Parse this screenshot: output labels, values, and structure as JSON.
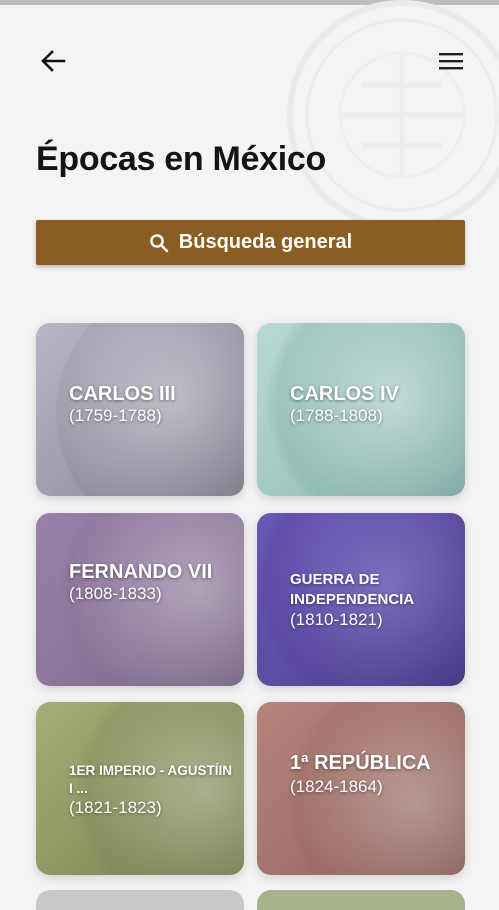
{
  "header": {
    "title": "Épocas en México",
    "back_icon": "arrow-left-icon",
    "menu_icon": "hamburger-menu-icon"
  },
  "search": {
    "label": "Búsqueda general",
    "icon": "search-icon",
    "color": "#8a5e22"
  },
  "eras": [
    {
      "name": "CARLOS III",
      "years": "(1759-1788)"
    },
    {
      "name": "CARLOS IV",
      "years": "(1788-1808)"
    },
    {
      "name": "FERNANDO VII",
      "years": "(1808-1833)"
    },
    {
      "name": "GUERRA DE INDEPENDENCIA",
      "years": "(1810-1821)"
    },
    {
      "name": "1ER IMPERIO - AGUSTÍIN I ...",
      "years": "(1821-1823)"
    },
    {
      "name": "1ª REPÚBLICA",
      "years": "(1824-1864)"
    }
  ]
}
